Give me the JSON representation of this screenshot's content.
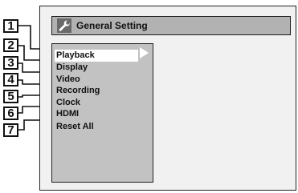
{
  "window": {
    "title": "General Setting",
    "title_icon": "wrench-icon"
  },
  "menu": {
    "items": [
      {
        "label": "Playback",
        "selected": true
      },
      {
        "label": "Display",
        "selected": false
      },
      {
        "label": "Video",
        "selected": false
      },
      {
        "label": "Recording",
        "selected": false
      },
      {
        "label": "Clock",
        "selected": false
      },
      {
        "label": "HDMI",
        "selected": false
      },
      {
        "label": "Reset All",
        "selected": false
      }
    ],
    "submenu_arrow": "right-triangle-icon"
  },
  "callouts": [
    "1",
    "2",
    "3",
    "4",
    "5",
    "6",
    "7"
  ],
  "colors": {
    "screen_bg": "#f1f1f1",
    "title_bar": "#b2b2b2",
    "menu_bg": "#c2c2c2",
    "selected_bg": "#ffffff",
    "icon_bg": "#6a6a6a"
  }
}
